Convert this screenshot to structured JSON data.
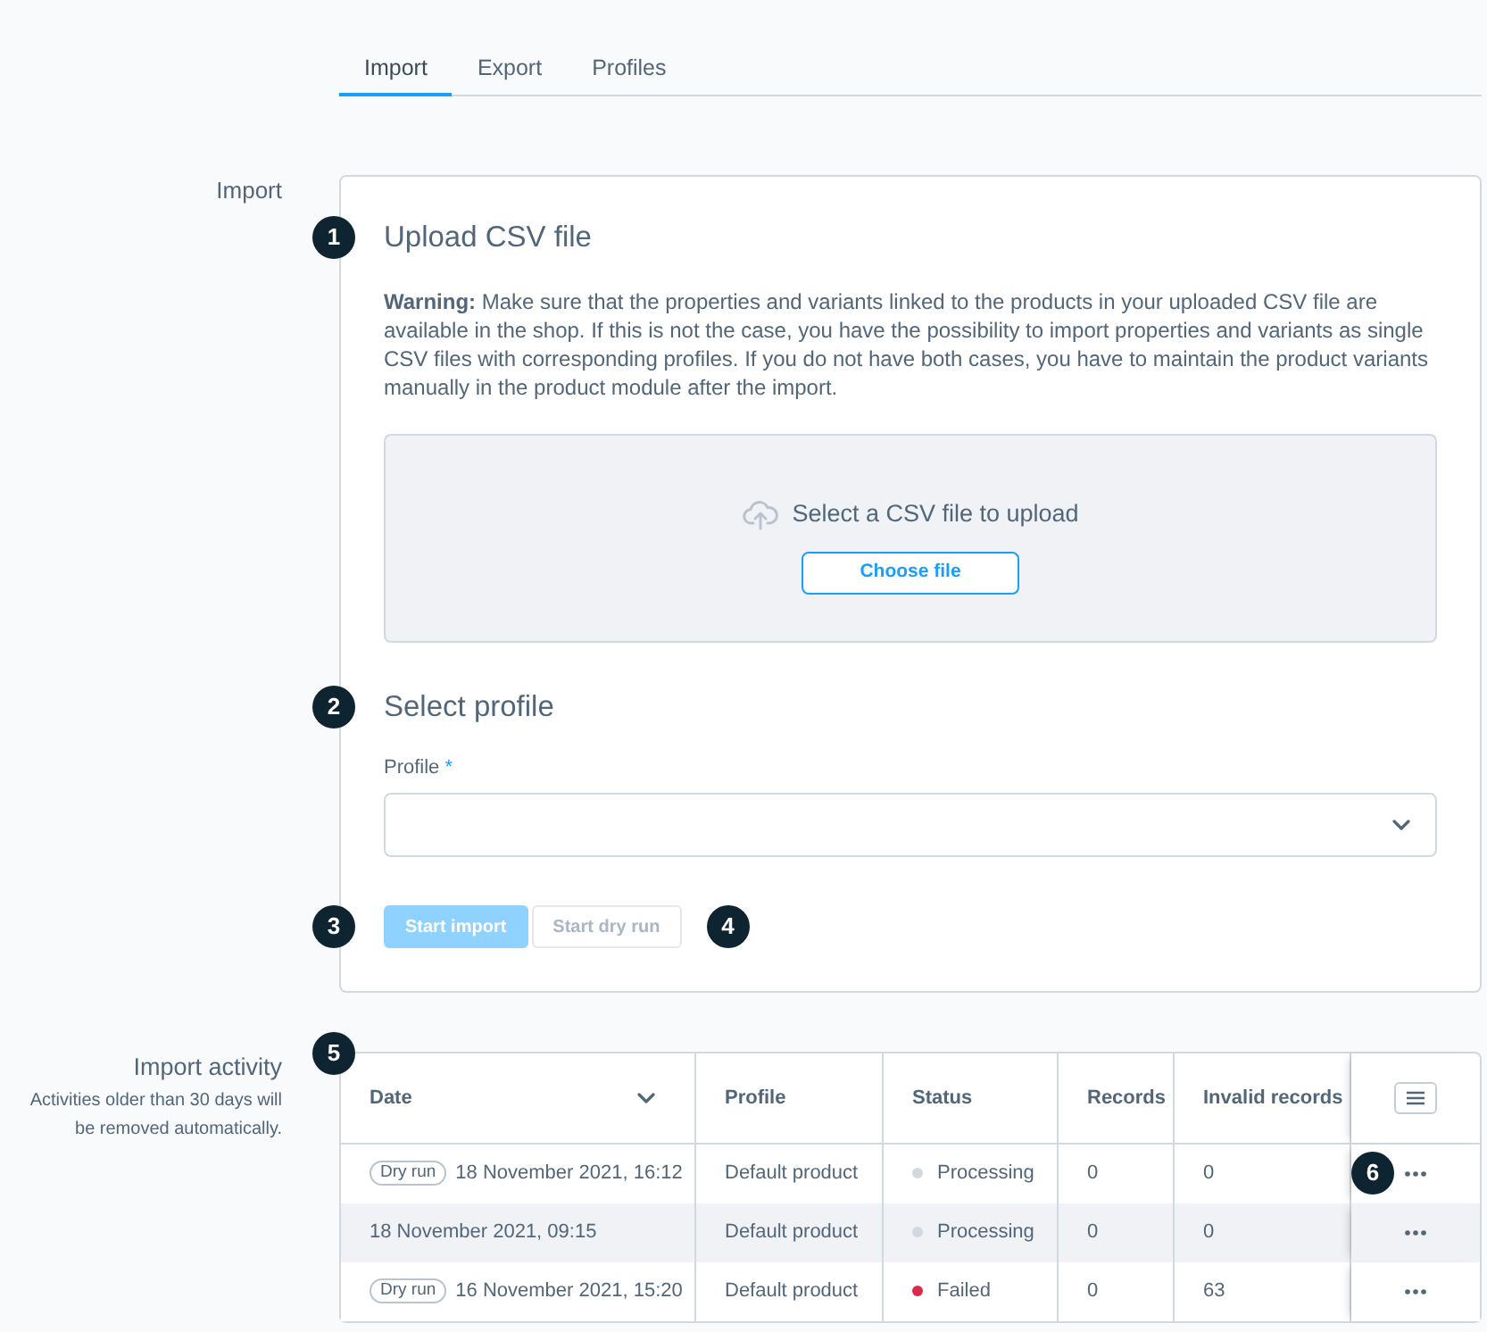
{
  "tabs": [
    {
      "label": "Import",
      "selected": true
    },
    {
      "label": "Export",
      "selected": false
    },
    {
      "label": "Profiles",
      "selected": false
    }
  ],
  "import": {
    "label": "Import",
    "upload": {
      "step": "1",
      "title": "Upload CSV file",
      "warning": "**Warning:** Make sure that the properties and variants linked to the products in your uploaded CSV file are available in the shop. If this is not the case, you have the possibility to import properties and variants as single CSV files with corresponding profiles. If you do not have both cases, you have to maintain the product variants manually in the product module after the import.",
      "dropzone_text": "Select a CSV file to upload",
      "choose_button": "Choose file"
    },
    "profile": {
      "step": "2",
      "title": "Select profile",
      "label": "Profile",
      "required_mark": "*"
    },
    "actions": [
      {
        "kind": "primary",
        "label": "Start import",
        "disabled": true,
        "step": "3"
      },
      {
        "kind": "secondary",
        "label": "Start dry run",
        "disabled": true,
        "step": "4"
      }
    ]
  },
  "activity": {
    "label": "Import activity",
    "note": "Activities older than 30 days will be removed automatically.",
    "step": "5",
    "columns": [
      {
        "label": "Date",
        "menu": true
      },
      {
        "label": "Profile",
        "menu": false
      },
      {
        "label": "Status",
        "menu": false
      },
      {
        "label": "Records",
        "menu": false
      },
      {
        "label": "Invalid records",
        "menu": false
      }
    ],
    "rows": [
      {
        "tag": "Dry run",
        "date": "18 November 2021, 16:12",
        "profile": "Default product",
        "status": "Processing",
        "color": "#d1d9e0",
        "records": "0",
        "invalid_records": "0",
        "highlighted": false,
        "step": "6"
      },
      {
        "date": "18 November 2021, 09:15",
        "profile": "Default product",
        "status": "Processing",
        "color": "#d1d9e0",
        "records": "0",
        "invalid_records": "0",
        "highlighted": true
      },
      {
        "tag": "Dry run",
        "date": "16 November 2021, 15:20",
        "profile": "Default product",
        "status": "Failed",
        "color": "#de294c",
        "records": "0",
        "invalid_records": "63",
        "highlighted": false
      }
    ]
  }
}
